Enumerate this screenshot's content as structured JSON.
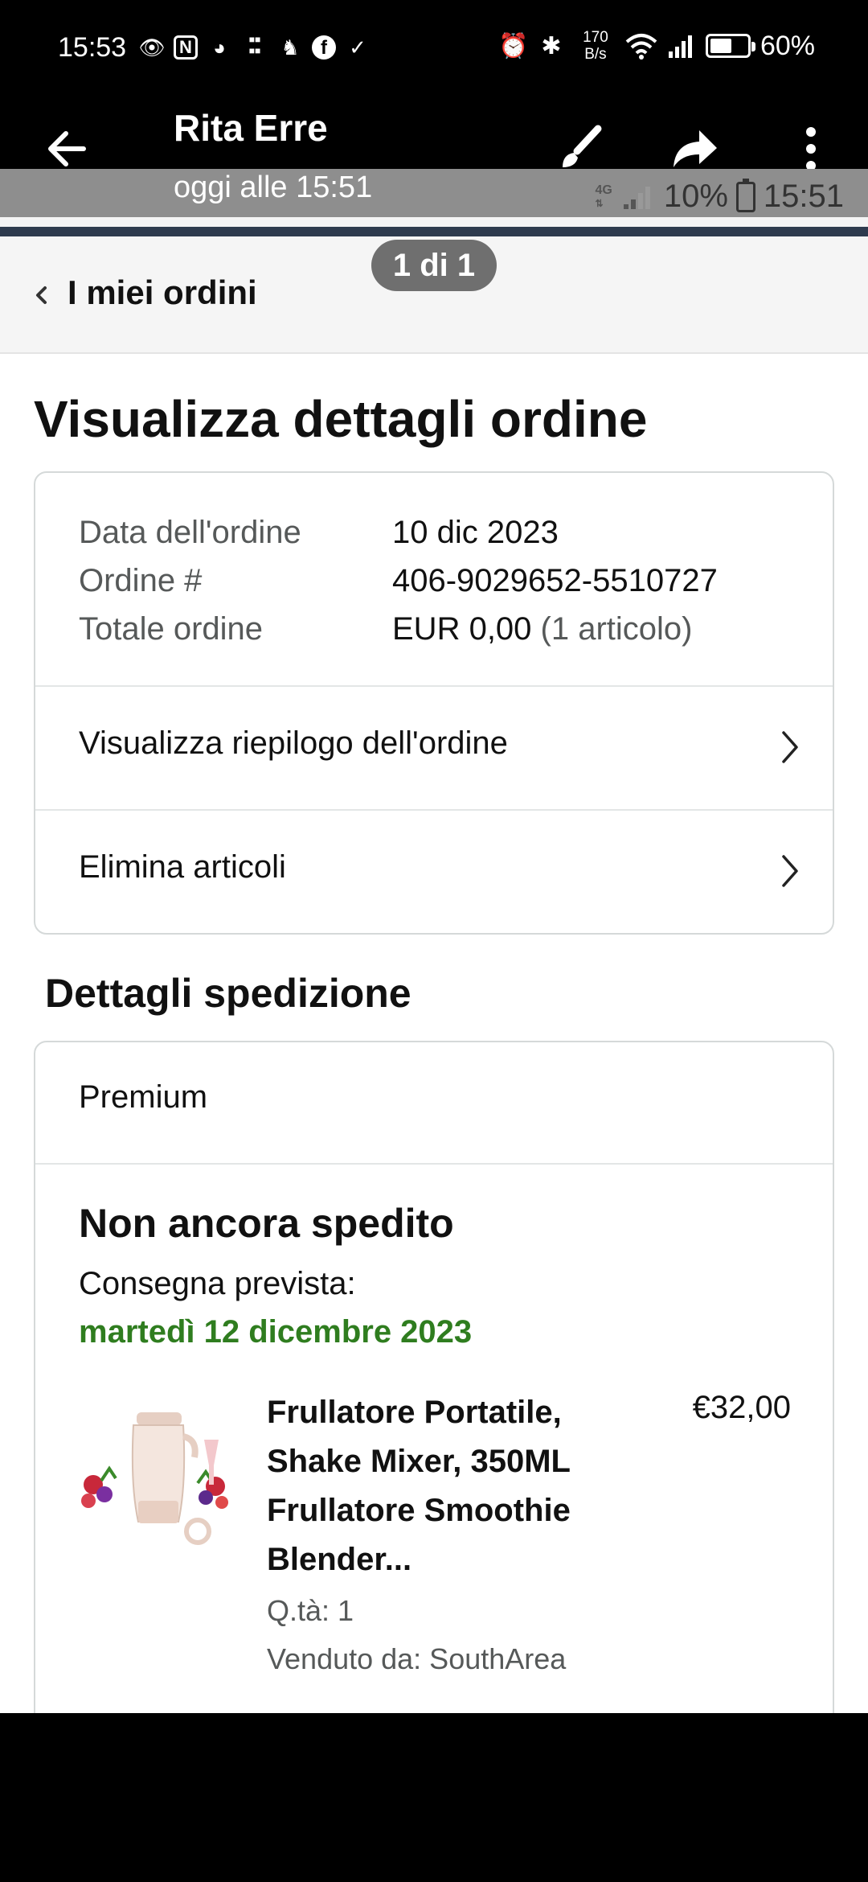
{
  "status_bar": {
    "time": "15:53",
    "speed_value": "170",
    "speed_unit": "B/s",
    "battery_percent": "60%",
    "battery_level": 0.6,
    "notification_icons": [
      "eye-icon",
      "nfc-icon",
      "messenger-icon",
      "temu-icon",
      "cat-icon",
      "facebook-icon",
      "download-check-icon"
    ]
  },
  "viewer": {
    "title": "Rita Erre",
    "subtitle": "oggi alle 15:51",
    "pager": "1 di 1"
  },
  "inner_status": {
    "network": "4G",
    "battery_percent": "10%",
    "time": "15:51"
  },
  "breadcrumb": {
    "label": "I miei ordini"
  },
  "page": {
    "title": "Visualizza dettagli ordine"
  },
  "order_info": {
    "date_label": "Data dell'ordine",
    "date_value": "10 dic 2023",
    "number_label": "Ordine #",
    "number_value": "406-9029652-5510727",
    "total_label": "Totale ordine",
    "total_value": "EUR 0,00",
    "total_items": "(1 articolo)"
  },
  "order_actions": {
    "summary_label": "Visualizza riepilogo dell'ordine",
    "delete_label": "Elimina articoli"
  },
  "shipping": {
    "section_title": "Dettagli spedizione",
    "service": "Premium",
    "status": "Non ancora spedito",
    "delivery_label": "Consegna prevista:",
    "delivery_date": "martedì 12 dicembre 2023",
    "delivery_color": "#2f7d1f"
  },
  "product": {
    "title": "Frullatore Portatile, Shake Mixer, 350ML Frullatore Smoothie Blender...",
    "price": "€32,00",
    "quantity": "Q.tà: 1",
    "seller": "Venduto da: SouthArea"
  }
}
